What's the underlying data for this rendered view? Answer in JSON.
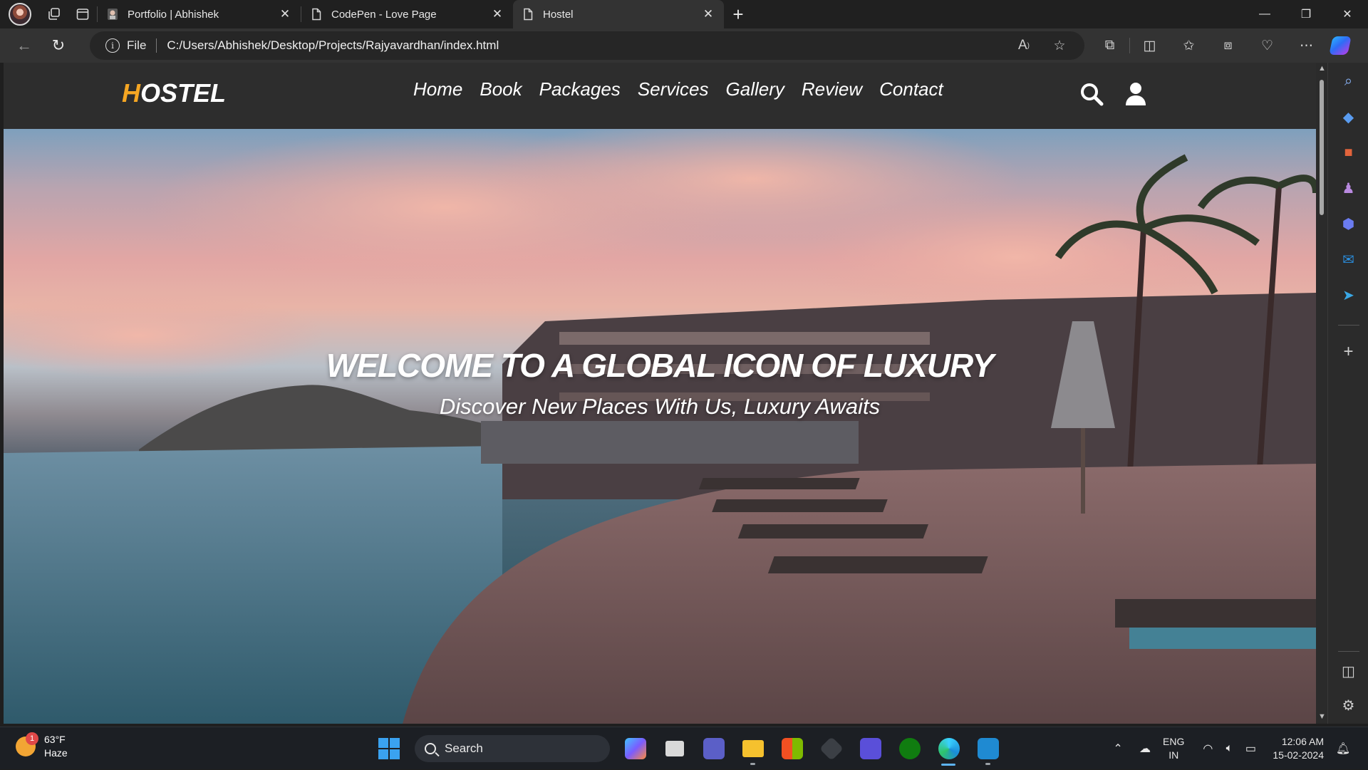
{
  "browser": {
    "tabs": [
      {
        "title": "Portfolio | Abhishek",
        "active": false
      },
      {
        "title": "CodePen - Love Page",
        "active": false
      },
      {
        "title": "Hostel",
        "active": true
      }
    ],
    "address": {
      "scheme_label": "File",
      "url": "C:/Users/Abhishek/Desktop/Projects/Rajyavardhan/index.html"
    }
  },
  "site": {
    "logo_accent": "H",
    "logo_rest": "OSTEL",
    "nav": [
      "Home",
      "Book",
      "Packages",
      "Services",
      "Gallery",
      "Review",
      "Contact"
    ],
    "hero_title": "WELCOME TO A GLOBAL ICON OF LUXURY",
    "hero_subtitle": "Discover New Places With Us, Luxury Awaits",
    "colors": {
      "accent": "#f5a623",
      "header_bg": "#2d2d2d"
    }
  },
  "taskbar": {
    "weather_temp": "63°F",
    "weather_desc": "Haze",
    "weather_badge": "1",
    "search_placeholder": "Search",
    "lang_top": "ENG",
    "lang_bottom": "IN",
    "time": "12:06 AM",
    "date": "15-02-2024"
  }
}
